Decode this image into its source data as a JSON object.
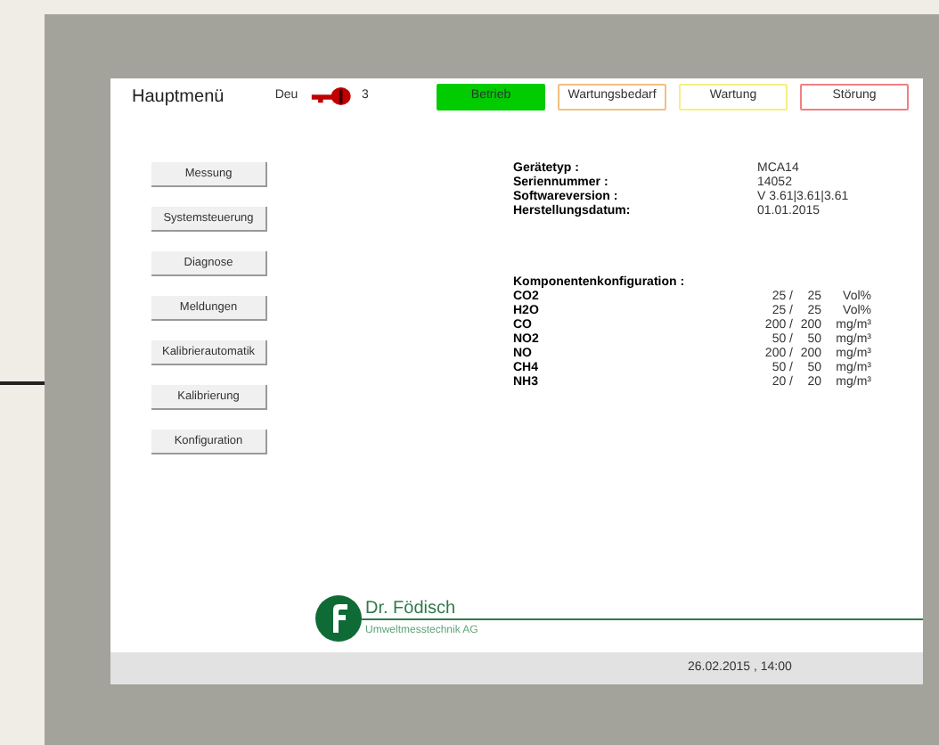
{
  "header": {
    "title": "Hauptmenü",
    "language": "Deu",
    "access_level": "3"
  },
  "status_indicators": [
    {
      "label": "Betrieb",
      "active": true,
      "color": "#00cc00"
    },
    {
      "label": "Wartungsbedarf",
      "active": false,
      "color": "#f0c080"
    },
    {
      "label": "Wartung",
      "active": false,
      "color": "#f5f080"
    },
    {
      "label": "Störung",
      "active": false,
      "color": "#f08080"
    }
  ],
  "menu_buttons": [
    "Messung",
    "Systemsteuerung",
    "Diagnose",
    "Meldungen",
    "Kalibrierautomatik",
    "Kalibrierung",
    "Konfiguration"
  ],
  "device_info": [
    {
      "label": "Gerätetyp :",
      "value": "MCA14"
    },
    {
      "label": "Seriennummer :",
      "value": "14052"
    },
    {
      "label": "Softwareversion :",
      "value": "V 3.61|3.61|3.61"
    },
    {
      "label": "Herstellungsdatum:",
      "value": "01.01.2015"
    }
  ],
  "components": {
    "title": "Komponentenkonfiguration :",
    "rows": [
      {
        "name": "CO2",
        "range_1": "25 /",
        "range_2": "25",
        "unit": "Vol%"
      },
      {
        "name": "H2O",
        "range_1": "25 /",
        "range_2": "25",
        "unit": "Vol%"
      },
      {
        "name": "CO",
        "range_1": "200 /",
        "range_2": "200",
        "unit": "mg/m³"
      },
      {
        "name": "NO2",
        "range_1": "50 /",
        "range_2": "50",
        "unit": "mg/m³"
      },
      {
        "name": "NO",
        "range_1": "200 /",
        "range_2": "200",
        "unit": "mg/m³"
      },
      {
        "name": "CH4",
        "range_1": "50 /",
        "range_2": "50",
        "unit": "mg/m³"
      },
      {
        "name": "NH3",
        "range_1": "20 /",
        "range_2": "20",
        "unit": "mg/m³"
      }
    ]
  },
  "logo": {
    "name": "Dr. Födisch",
    "subtitle": "Umweltmesstechnik AG"
  },
  "status_bar": {
    "datetime": "26.02.2015 , 14:00"
  }
}
